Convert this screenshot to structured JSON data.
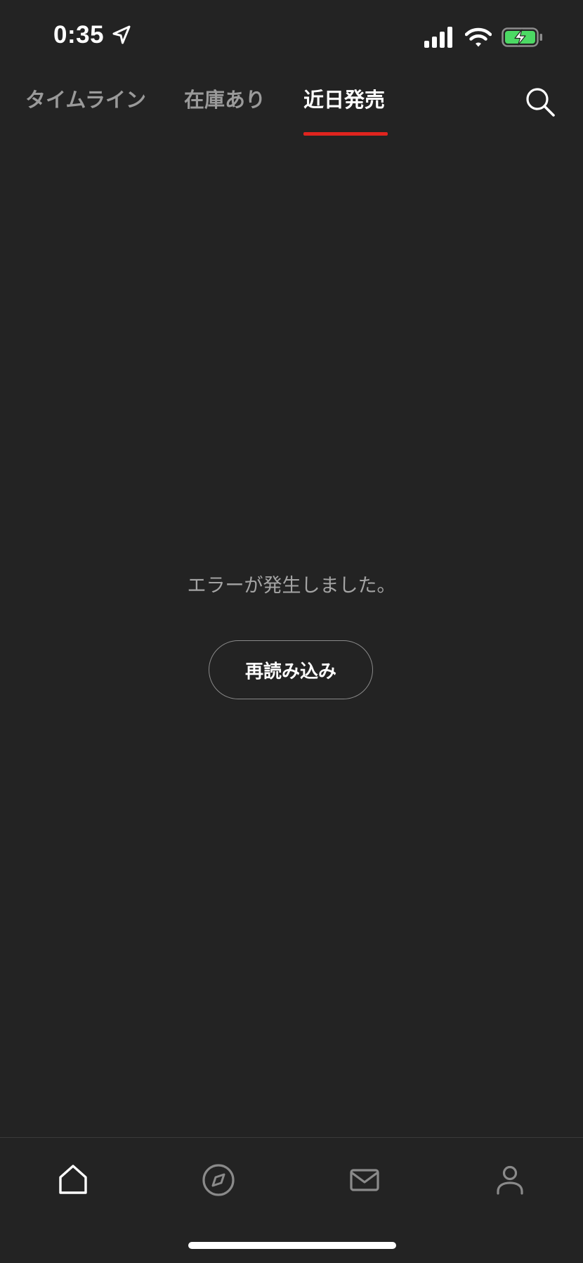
{
  "status_bar": {
    "time": "0:35",
    "icons": [
      "location-arrow-icon",
      "cellular-signal-icon",
      "wifi-icon",
      "battery-charging-icon"
    ]
  },
  "tabs": [
    {
      "label": "タイムライン",
      "active": false
    },
    {
      "label": "在庫あり",
      "active": false
    },
    {
      "label": "近日発売",
      "active": true
    }
  ],
  "header": {
    "search_icon": "search-icon"
  },
  "main": {
    "error_message": "エラーが発生しました。",
    "reload_label": "再読み込み"
  },
  "bottom_nav": {
    "items": [
      {
        "icon": "home-icon",
        "active": true
      },
      {
        "icon": "compass-icon",
        "active": false
      },
      {
        "icon": "mail-icon",
        "active": false
      },
      {
        "icon": "profile-icon",
        "active": false
      }
    ]
  },
  "colors": {
    "background": "#232323",
    "accent": "#e0241e",
    "inactive_text": "#9a9a9a",
    "battery_fill": "#4cd964"
  }
}
